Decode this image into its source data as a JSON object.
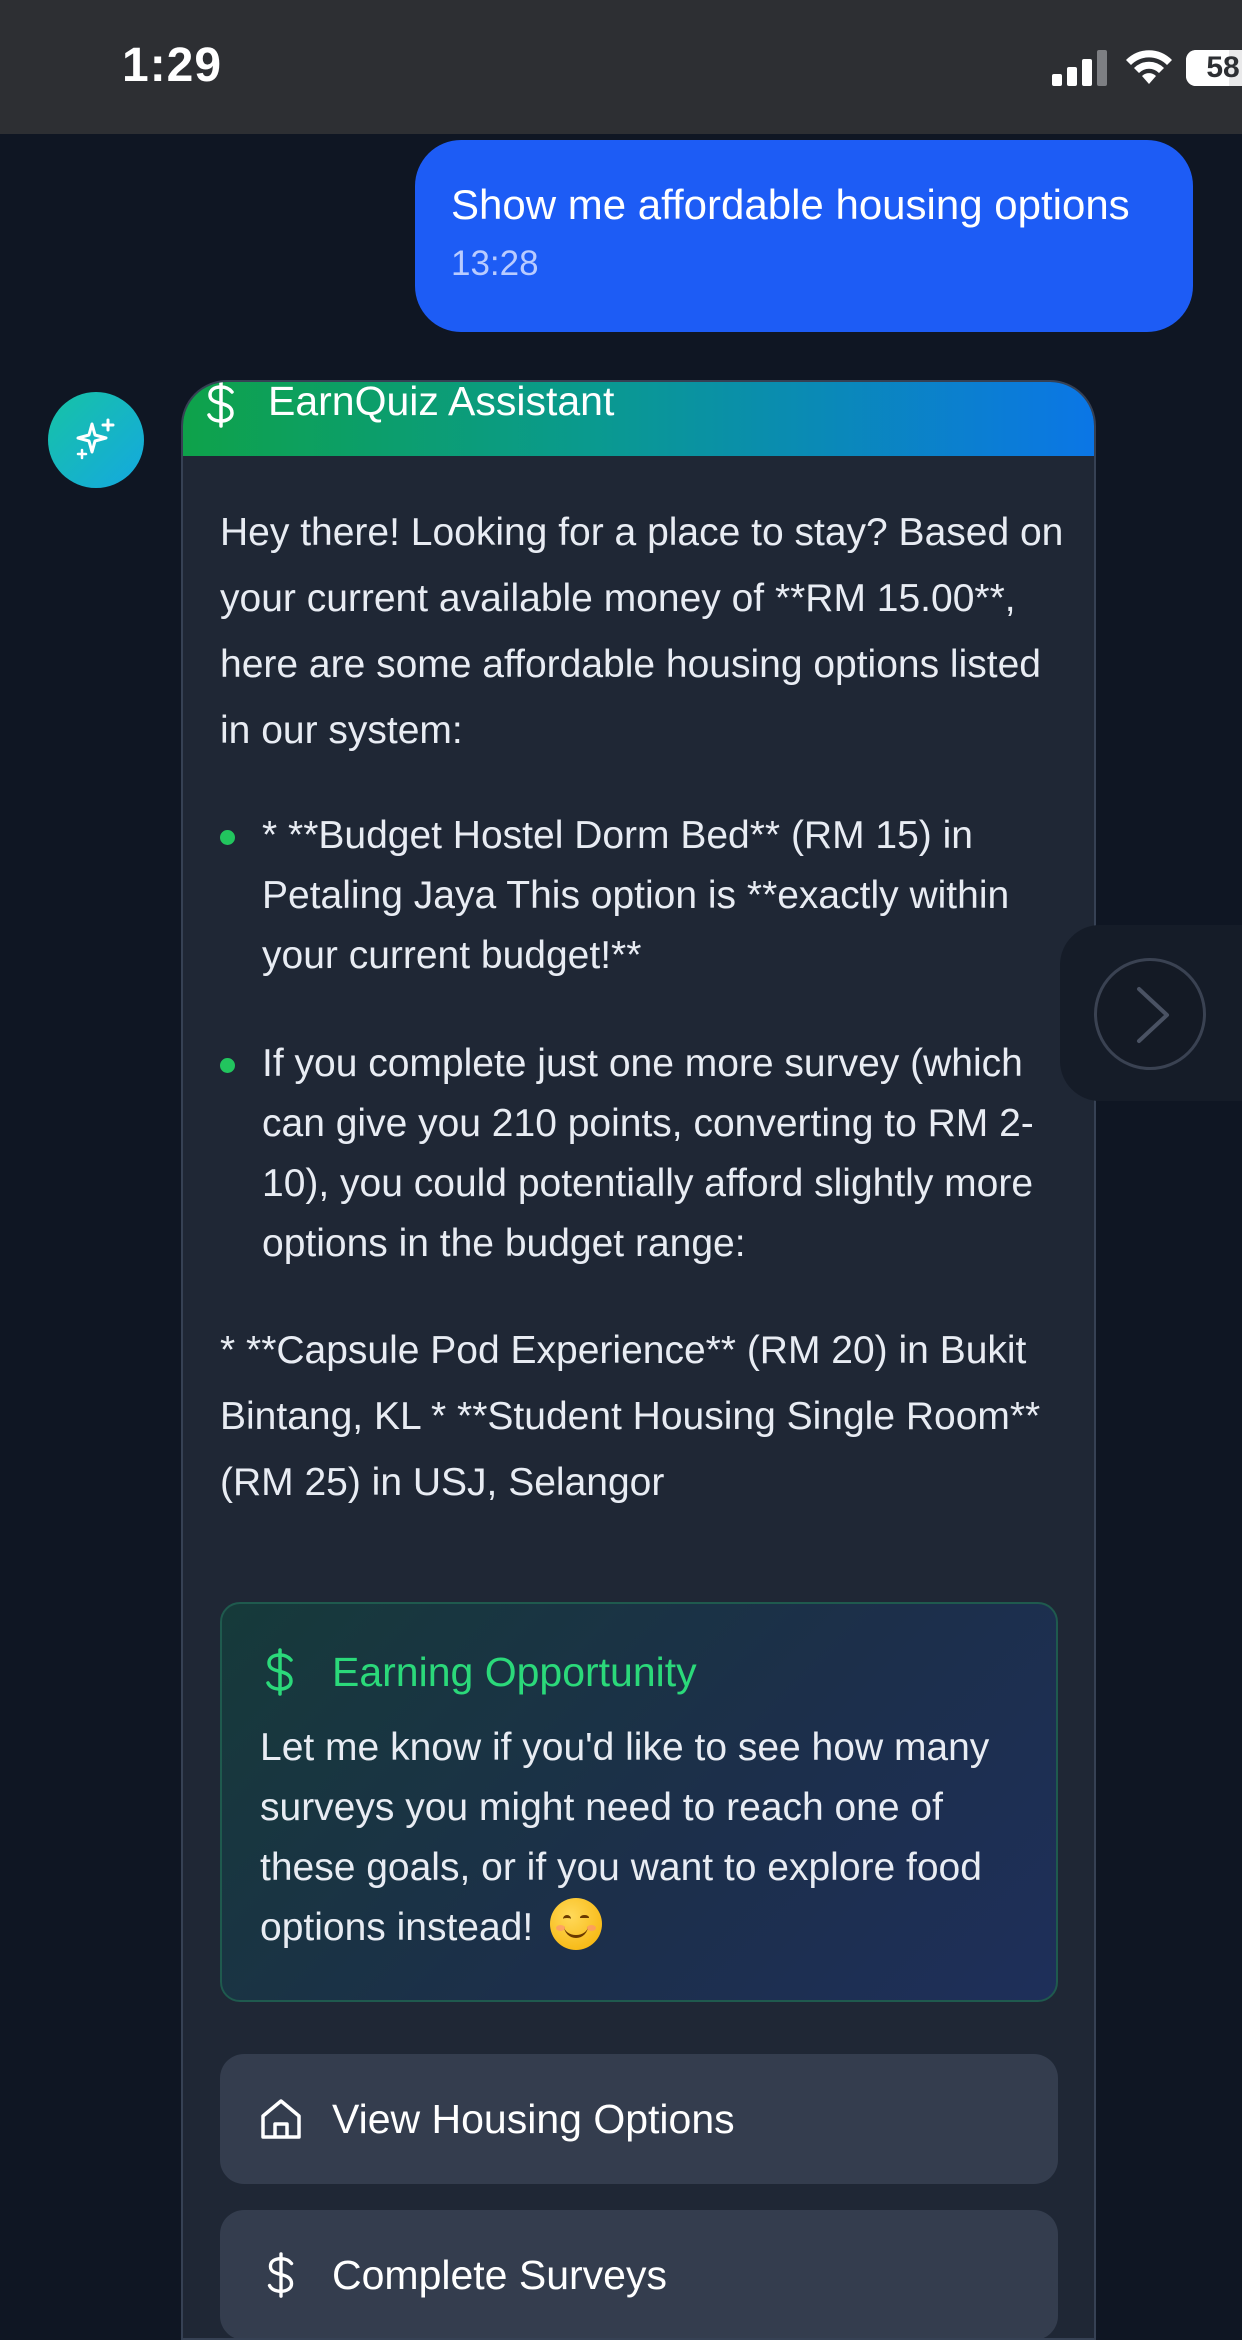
{
  "status_bar": {
    "time": "1:29",
    "battery": "58",
    "battery_level": 0.58
  },
  "user_message": {
    "text": "Show me affordable housing options",
    "time": "13:28"
  },
  "assistant": {
    "avatar_icon": "sparkles-icon",
    "header_icon": "dollar-icon",
    "title": "EarnQuiz Assistant",
    "intro": "Hey there! Looking for a place to stay? Based on your current available money of **RM 15.00**, here are some affordable housing options listed in our system:",
    "bullets": [
      "* **Budget Hostel Dorm Bed** (RM 15) in Petaling Jaya This option is **exactly within your current budget!**",
      "If you complete just one more survey (which can give you 210 points, converting to RM 2-10), you could potentially afford slightly more options in the budget range:"
    ],
    "extra": "* **Capsule Pod Experience** (RM 20) in Bukit Bintang, KL * **Student Housing Single Room** (RM 25) in USJ, Selangor",
    "earning_box": {
      "icon": "dollar-icon",
      "title": "Earning Opportunity",
      "text": "Let me know if you'd like to see how many surveys you might need to reach one of these goals, or if you want to explore food options instead!",
      "emoji": "😊"
    },
    "actions": [
      {
        "icon": "home-icon",
        "label": "View Housing Options"
      },
      {
        "icon": "dollar-icon",
        "label": "Complete Surveys"
      }
    ]
  },
  "colors": {
    "background": "#0f1623",
    "user_bubble": "#1d5cf5",
    "accent_green": "#22c55e",
    "card": "#1f2735"
  }
}
